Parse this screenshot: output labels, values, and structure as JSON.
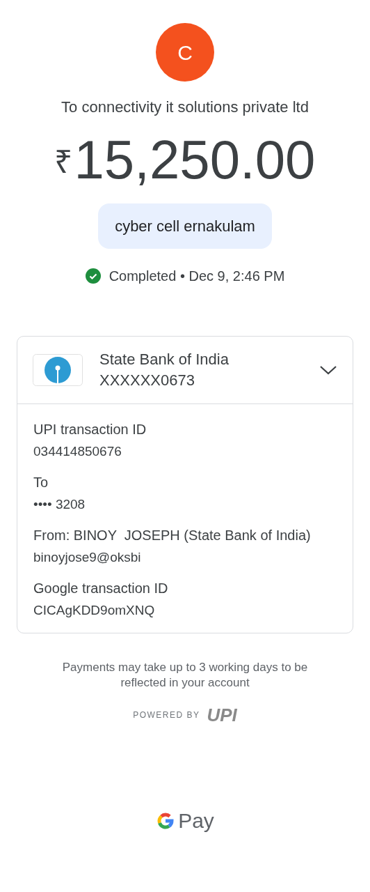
{
  "payee": {
    "initial": "C",
    "color": "#f4511e",
    "title": "To connectivity it solutions private ltd"
  },
  "amount": {
    "currency": "₹",
    "value": "15,250.00"
  },
  "note": "cyber cell ernakulam",
  "status": {
    "kind": "completed",
    "label": "Completed",
    "separator": "•",
    "time": "Dec 9, 2:46 PM"
  },
  "account": {
    "bank": "State Bank of India",
    "number": "XXXXXX0673",
    "expanded": true,
    "details": [
      {
        "label": "UPI transaction ID",
        "value": "034414850676"
      },
      {
        "label": "To",
        "value": "•••• 3208"
      },
      {
        "label": "From: BINOY  JOSEPH (State Bank of India)",
        "value": "binoyjose9@oksbi"
      },
      {
        "label": "Google transaction ID",
        "value": "CICAgKDD9omXNQ"
      }
    ]
  },
  "footnote": "Payments may take up to 3 working days to be reflected in your account",
  "powered_by": {
    "label": "POWERED BY",
    "logo": "UPI"
  },
  "brand": "Pay"
}
